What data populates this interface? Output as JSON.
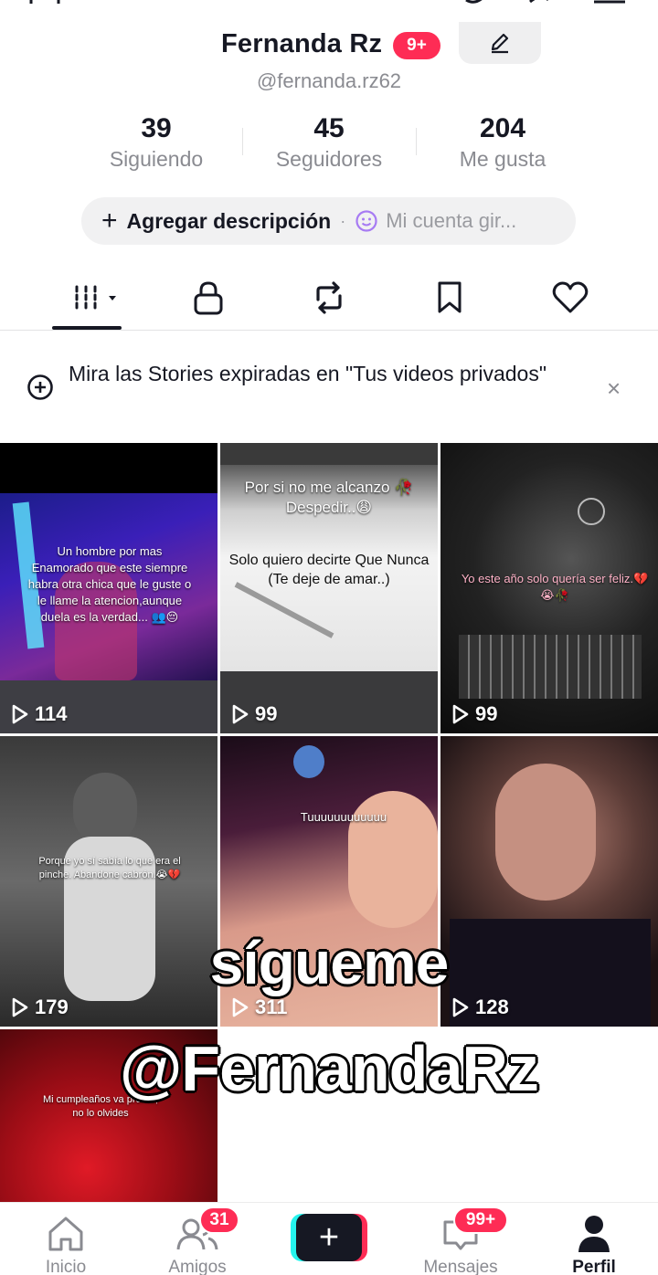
{
  "profile": {
    "name": "Fernanda Rz",
    "name_badge": "9+",
    "handle": "@fernanda.rz62"
  },
  "stats": [
    {
      "value": "39",
      "label": "Siguiendo"
    },
    {
      "value": "45",
      "label": "Seguidores"
    },
    {
      "value": "204",
      "label": "Me gusta"
    }
  ],
  "description": {
    "add_label": "Agregar descripción",
    "separator": "·",
    "bio_preview": "Mi cuenta gir..."
  },
  "tabs": [
    {
      "name": "videos",
      "icon": "grid-icon",
      "active": true
    },
    {
      "name": "private",
      "icon": "lock-icon"
    },
    {
      "name": "reposts",
      "icon": "repost-icon"
    },
    {
      "name": "saved",
      "icon": "bookmark-icon"
    },
    {
      "name": "liked",
      "icon": "heart-icon"
    }
  ],
  "banner": {
    "text": "Mira las Stories expiradas en \"Tus videos privados\"",
    "close": "×"
  },
  "videos": [
    {
      "views": "114",
      "caption": "Un hombre por mas Enamorado que este siempre habra otra chica que le guste o le llame la atencion,aunque duela es la verdad... 👥😔"
    },
    {
      "views": "99",
      "caption_top": "Por si no me alcanzo 🥀Despedir..😩",
      "caption_bottom": "Solo quiero decirte Que Nunca (Te deje de amar..)"
    },
    {
      "views": "99",
      "caption": "Yo este año solo quería ser feliz.💔😭🥀"
    },
    {
      "views": "179",
      "caption": "Porque yo sí sabía lo que era el pinche. Abandone cabrón.😭💔"
    },
    {
      "views": "311",
      "caption": "Tuuuuuuuuuuuu"
    },
    {
      "views": "128",
      "caption": ""
    },
    {
      "views": "",
      "caption": "Mi cumpleaños va pronto, no lo olvides"
    }
  ],
  "overlay": {
    "line1": "sígueme",
    "line2": "@FernandaRz"
  },
  "bottom_nav": [
    {
      "label": "Inicio",
      "icon": "home-icon"
    },
    {
      "label": "Amigos",
      "icon": "friends-icon",
      "badge": "31"
    },
    {
      "label": "",
      "icon": "plus-icon"
    },
    {
      "label": "Mensajes",
      "icon": "inbox-icon",
      "badge": "99+"
    },
    {
      "label": "Perfil",
      "icon": "profile-icon",
      "active": true
    }
  ],
  "colors": {
    "accent": "#fe2c55",
    "cyan": "#25f4ee",
    "text": "#161823",
    "muted": "#8a8b91"
  }
}
